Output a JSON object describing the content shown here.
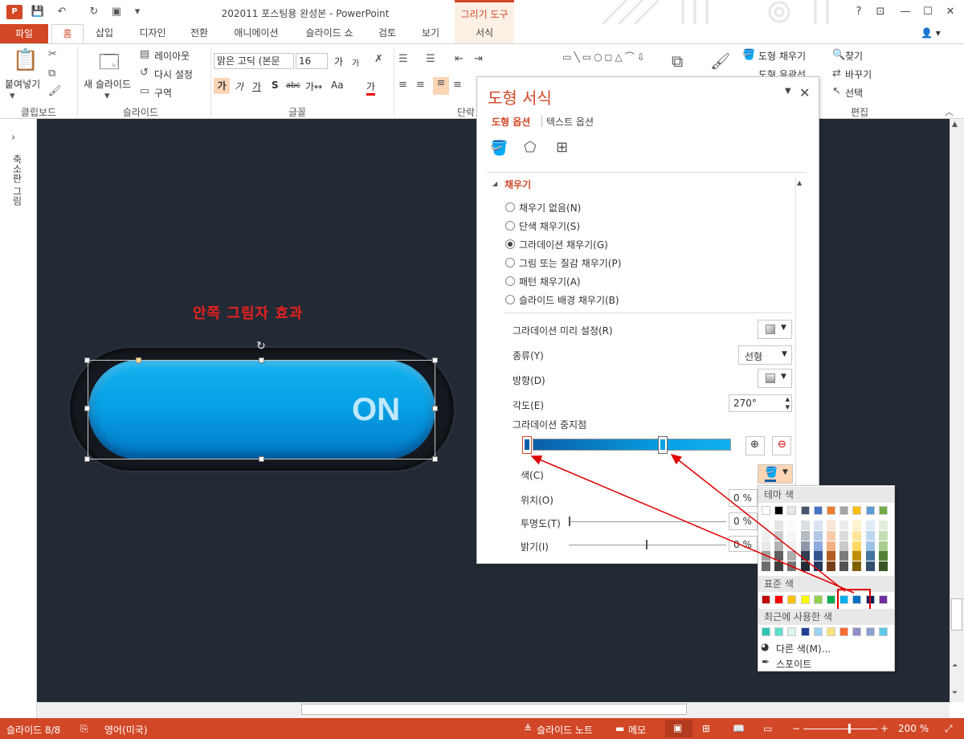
{
  "app": {
    "doc_title": "202011 포스팅용 완성본 - PowerPoint",
    "tool_context": "그리기 도구",
    "qat_logo": "P",
    "help": "?",
    "win_buttons": [
      "—",
      "☐",
      "✕"
    ]
  },
  "tabs": [
    "파일",
    "홈",
    "삽입",
    "디자인",
    "전환",
    "애니메이션",
    "슬라이드 쇼",
    "검토",
    "보기",
    "서식"
  ],
  "ribbon": {
    "clipboard": {
      "paste": "붙여넣기",
      "label": "클립보드"
    },
    "slides": {
      "new_slide": "새 슬라이드",
      "layout": "레이아웃",
      "reset": "다시 설정",
      "section": "구역",
      "label": "슬라이드"
    },
    "font": {
      "font_name": "맑은 고딕 (본문",
      "font_size": "16",
      "label": "글꼴",
      "bold": "가",
      "italic": "가",
      "underline": "가",
      "shadow": "S",
      "strike": "abc",
      "spacing": "가↔",
      "case": "Aa",
      "color": "가",
      "grow": "가",
      "shrink": "가"
    },
    "paragraph": {
      "label": "단락"
    },
    "drawing": {
      "fill": "도형 채우기",
      "outline": "도형 윤곽선"
    },
    "editing": {
      "find": "찾기",
      "replace": "바꾸기",
      "select": "선택",
      "label": "편집"
    }
  },
  "thumbpane": {
    "label": "축소판 그림"
  },
  "slide": {
    "effect_label": "안쪽 그림자 효과",
    "button_text": "ON"
  },
  "format_pane": {
    "title": "도형 서식",
    "tab_shape": "도형 옵션",
    "tab_text": "텍스트 옵션",
    "fill_header": "채우기",
    "options": [
      {
        "label": "채우기 없음(N)",
        "selected": false
      },
      {
        "label": "단색 채우기(S)",
        "selected": false
      },
      {
        "label": "그라데이션 채우기(G)",
        "selected": true
      },
      {
        "label": "그림 또는 질감 채우기(P)",
        "selected": false
      },
      {
        "label": "패턴 채우기(A)",
        "selected": false
      },
      {
        "label": "슬라이드 배경 채우기(B)",
        "selected": false
      }
    ],
    "preset_label": "그라데이션 미리 설정(R)",
    "type_label": "종류(Y)",
    "type_value": "선형",
    "direction_label": "방향(D)",
    "angle_label": "각도(E)",
    "angle_value": "270°",
    "stops_label": "그라데이션 중지점",
    "color_label": "색(C)",
    "position_label": "위치(O)",
    "position_value": "0 %",
    "transparency_label": "투명도(T)",
    "transparency_value": "0 %",
    "brightness_label": "밝기(I)",
    "brightness_value": "0 %"
  },
  "palette": {
    "theme_header": "테마 색",
    "standard_header": "표준 색",
    "recent_header": "최근에 사용한 색",
    "more_colors": "다른 색(M)...",
    "eyedropper": "스포이트",
    "theme_top": [
      "#ffffff",
      "#000000",
      "#e7e6e6",
      "#44546a",
      "#4472c4",
      "#ed7d31",
      "#a5a5a5",
      "#ffc000",
      "#5b9bd5",
      "#70ad47"
    ],
    "standard": [
      "#c00000",
      "#ff0000",
      "#ffc000",
      "#ffff00",
      "#92d050",
      "#00b050",
      "#00b0f0",
      "#0070c0",
      "#002060",
      "#7030a0"
    ],
    "recent": [
      "#2ec4b6",
      "#5ce1c8",
      "#d8f5ee",
      "#1f3f96",
      "#9dd3f5",
      "#ffe27a",
      "#ff6b35",
      "#8c8fc8",
      "#8c9fd0",
      "#5bc8e8"
    ]
  },
  "status": {
    "slide": "슬라이드 8/8",
    "language": "영어(미국)",
    "notes": "슬라이드 노트",
    "comments": "메모",
    "zoom": "200 %"
  }
}
